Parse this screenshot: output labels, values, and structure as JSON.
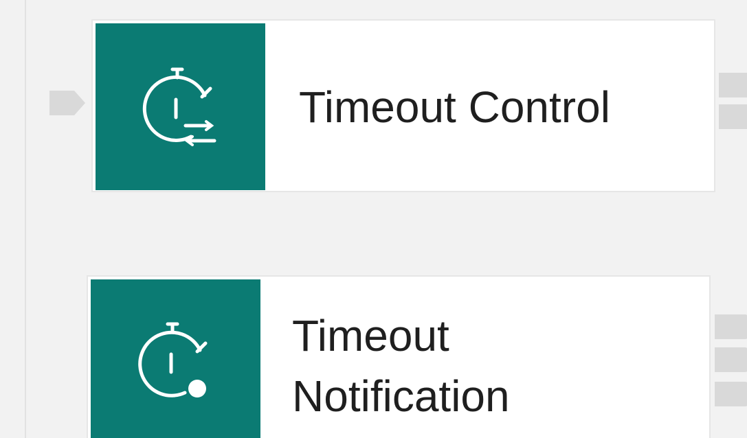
{
  "colors": {
    "canvas_bg": "#f2f2f2",
    "node_icon_bg": "#0b7b73",
    "port": "#d9d9d9",
    "label_text": "#1f1f1f"
  },
  "nodes": [
    {
      "label": "Timeout Control",
      "icon": "timeout-control-icon"
    },
    {
      "label": "Timeout\nNotification",
      "icon": "timeout-notification-icon"
    }
  ]
}
